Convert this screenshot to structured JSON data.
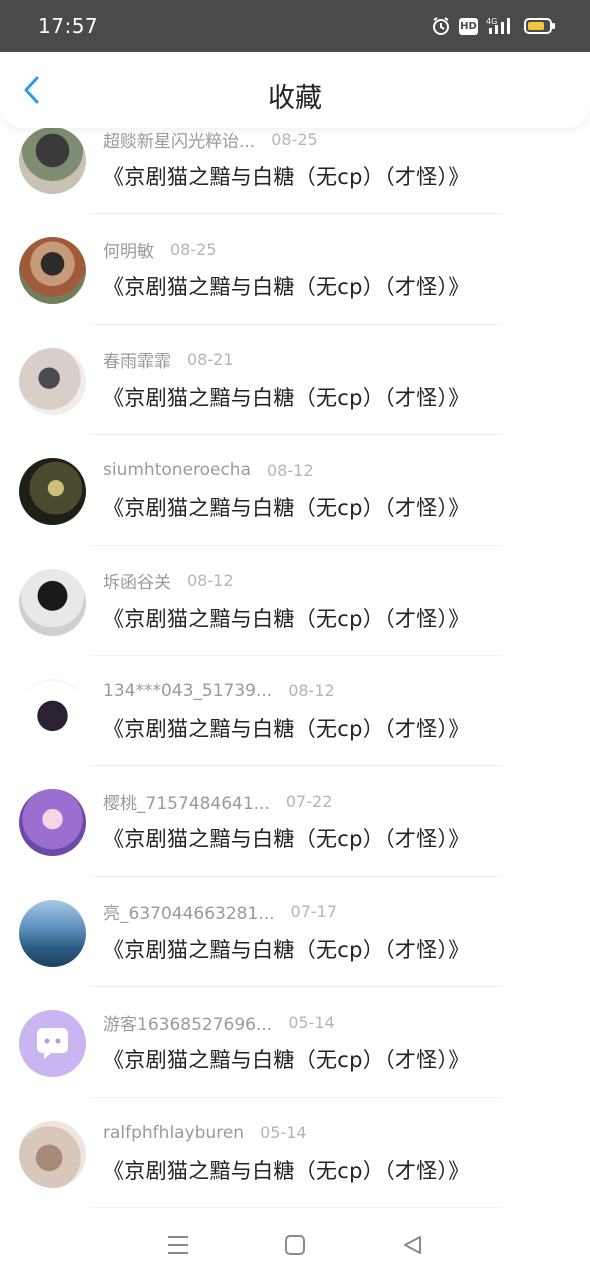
{
  "status_bar": {
    "time": "17:57",
    "hd_label": "HD",
    "network_label": "4G",
    "battery_color": "#f5c642"
  },
  "header": {
    "title": "收藏",
    "back_icon": "chevron-left-icon",
    "accent_color": "#2b9af3"
  },
  "items": [
    {
      "user": "超赕新星闪光粹诒...",
      "date": "08-25",
      "title": "《京剧猫之黯与白糖（无cp）（才怪）》"
    },
    {
      "user": "何明敏",
      "date": "08-25",
      "title": "《京剧猫之黯与白糖（无cp）（才怪）》"
    },
    {
      "user": "春雨霏霏",
      "date": "08-21",
      "title": "《京剧猫之黯与白糖（无cp）（才怪）》"
    },
    {
      "user": "siumhtoneroecha",
      "date": "08-12",
      "title": "《京剧猫之黯与白糖（无cp）（才怪）》"
    },
    {
      "user": "坼函谷关",
      "date": "08-12",
      "title": "《京剧猫之黯与白糖（无cp）（才怪）》"
    },
    {
      "user": "134***043_51739...",
      "date": "08-12",
      "title": "《京剧猫之黯与白糖（无cp）（才怪）》"
    },
    {
      "user": "樱桃_7157484641...",
      "date": "07-22",
      "title": "《京剧猫之黯与白糖（无cp）（才怪）》"
    },
    {
      "user": "亮_637044663281...",
      "date": "07-17",
      "title": "《京剧猫之黯与白糖（无cp）（才怪）》"
    },
    {
      "user": "游客16368527696...",
      "date": "05-14",
      "title": "《京剧猫之黯与白糖（无cp）（才怪）》"
    },
    {
      "user": "ralfphfhlayburen",
      "date": "05-14",
      "title": "《京剧猫之黯与白糖（无cp）（才怪）》"
    }
  ],
  "nav_bar": {
    "icons": [
      "menu-icon",
      "home-square-icon",
      "back-triangle-icon"
    ]
  }
}
